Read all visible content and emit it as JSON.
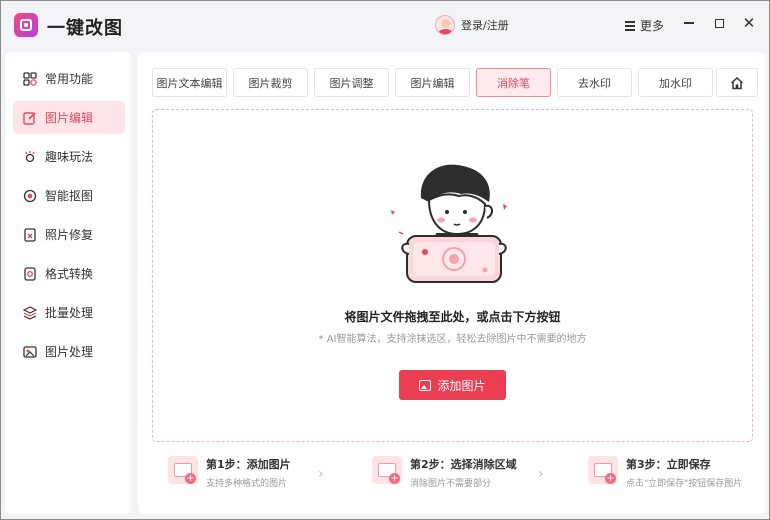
{
  "app": {
    "title": "一键改图"
  },
  "header": {
    "login_label": "登录/注册",
    "more_label": "更多"
  },
  "sidebar": {
    "items": [
      {
        "label": "常用功能",
        "icon": "grid-icon",
        "active": false
      },
      {
        "label": "图片编辑",
        "icon": "edit-icon",
        "active": true
      },
      {
        "label": "趣味玩法",
        "icon": "sparkle-icon",
        "active": false
      },
      {
        "label": "智能抠图",
        "icon": "cutout-icon",
        "active": false
      },
      {
        "label": "照片修复",
        "icon": "repair-icon",
        "active": false
      },
      {
        "label": "格式转换",
        "icon": "convert-icon",
        "active": false
      },
      {
        "label": "批量处理",
        "icon": "layers-icon",
        "active": false
      },
      {
        "label": "图片处理",
        "icon": "image-icon",
        "active": false
      }
    ]
  },
  "tabs": [
    {
      "label": "图片文本编辑",
      "active": false
    },
    {
      "label": "图片裁剪",
      "active": false
    },
    {
      "label": "图片调整",
      "active": false
    },
    {
      "label": "图片编辑",
      "active": false
    },
    {
      "label": "消除笔",
      "active": true
    },
    {
      "label": "去水印",
      "active": false
    },
    {
      "label": "加水印",
      "active": false
    }
  ],
  "dropzone": {
    "title": "将图片文件拖拽至此处，或点击下方按钮",
    "subtitle": "* AI智能算法，支持涂抹选区，轻松去除图片中不需要的地方",
    "button_label": "添加图片"
  },
  "steps": [
    {
      "title": "第1步：添加图片",
      "desc": "支持多种格式的图片"
    },
    {
      "title": "第2步：选择消除区域",
      "desc": "消除图片不需要部分"
    },
    {
      "title": "第3步：立即保存",
      "desc": "点击\"立即保存\"按钮保存图片"
    }
  ],
  "colors": {
    "accent": "#ec3e53",
    "accent_light": "#fde4e6",
    "logo_start": "#f04a7a",
    "logo_end": "#b53fe0"
  }
}
